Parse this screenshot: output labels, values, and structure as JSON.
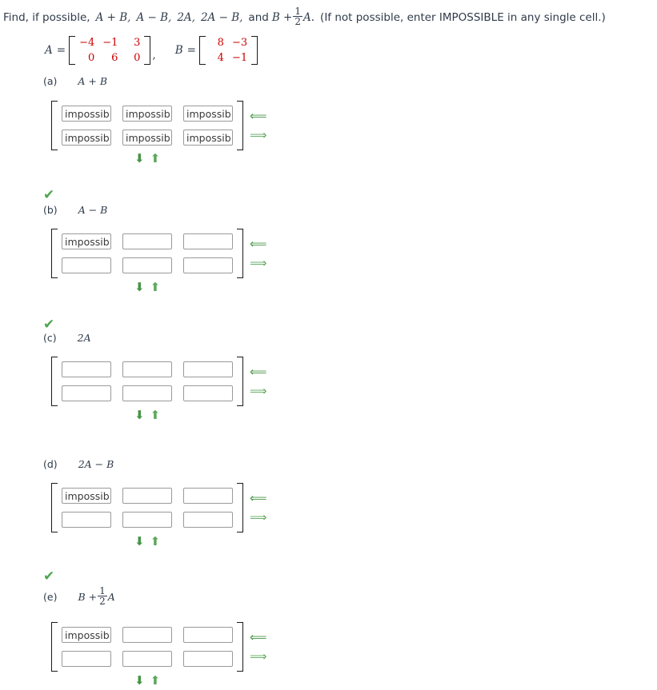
{
  "prompt": {
    "lead": "Find, if possible,",
    "expr1": "A + B,",
    "expr2": "A − B,",
    "expr3": "2A,",
    "expr4": "2A − B,",
    "and": "and",
    "expr5_lead": "B +",
    "expr5_frac_num": "1",
    "expr5_frac_den": "2",
    "expr5_tail": "A.",
    "note": "(If not possible, enter IMPOSSIBLE in any single cell.)"
  },
  "definitions": {
    "a_name": "A",
    "a_equals": "=",
    "a_values": [
      [
        "−4",
        "−1",
        "3"
      ],
      [
        "0",
        "6",
        "0"
      ]
    ],
    "separator": ",",
    "b_name": "B",
    "b_equals": "=",
    "b_values": [
      [
        "8",
        "−3"
      ],
      [
        "4",
        "−1"
      ]
    ]
  },
  "icons": {
    "check": "✔",
    "arrow_left": "⟸",
    "arrow_right": "⟹",
    "arrow_down": "⬇",
    "arrow_up": "⬆"
  },
  "parts": [
    {
      "id": "a",
      "label": "(a)",
      "expr": "A + B",
      "expr_kind": "plain",
      "checked": false,
      "cells": [
        [
          "impossib",
          "impossib",
          "impossib"
        ],
        [
          "impossib",
          "impossib",
          "impossib"
        ]
      ]
    },
    {
      "id": "b",
      "label": "(b)",
      "expr": "A − B",
      "expr_kind": "plain",
      "checked": true,
      "cells": [
        [
          "impossib",
          "",
          ""
        ],
        [
          "",
          "",
          ""
        ]
      ]
    },
    {
      "id": "c",
      "label": "(c)",
      "expr": "2A",
      "expr_kind": "plain",
      "checked": true,
      "cells": [
        [
          "",
          "",
          ""
        ],
        [
          "",
          "",
          ""
        ]
      ]
    },
    {
      "id": "d",
      "label": "(d)",
      "expr": "2A − B",
      "expr_kind": "plain",
      "checked": false,
      "cells": [
        [
          "impossib",
          "",
          ""
        ],
        [
          "",
          "",
          ""
        ]
      ]
    },
    {
      "id": "e",
      "label": "(e)",
      "expr_kind": "fraction",
      "expr_lead": "B +",
      "expr_frac_num": "1",
      "expr_frac_den": "2",
      "expr_tail": "A",
      "checked": true,
      "cells": [
        [
          "impossib",
          "",
          ""
        ],
        [
          "",
          "",
          ""
        ]
      ]
    }
  ],
  "colors": {
    "matrix_number": "#cc0000",
    "check_green": "#4ea64e",
    "arrow_green": "#5aa75a",
    "text": "#2f3b4a"
  }
}
